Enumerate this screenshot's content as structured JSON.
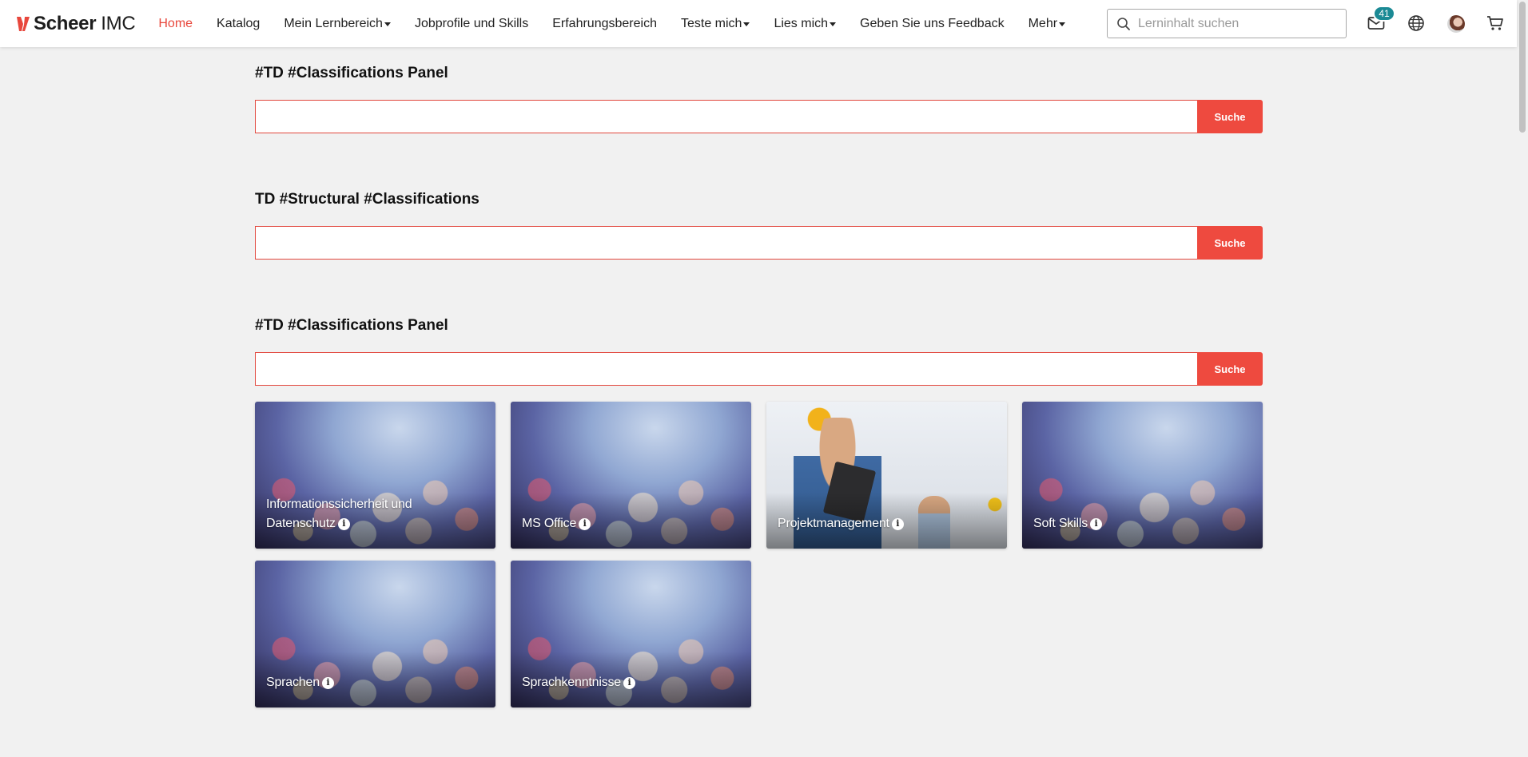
{
  "brand": {
    "name_bold": "Scheer",
    "name_light": "IMC",
    "accent": "#e8473c"
  },
  "nav": {
    "items": [
      {
        "label": "Home",
        "active": true,
        "dropdown": false
      },
      {
        "label": "Katalog",
        "active": false,
        "dropdown": false
      },
      {
        "label": "Mein Lernbereich",
        "active": false,
        "dropdown": true
      },
      {
        "label": "Jobprofile und Skills",
        "active": false,
        "dropdown": false
      },
      {
        "label": "Erfahrungsbereich",
        "active": false,
        "dropdown": false
      },
      {
        "label": "Teste mich",
        "active": false,
        "dropdown": true
      },
      {
        "label": "Lies mich",
        "active": false,
        "dropdown": true
      },
      {
        "label": "Geben Sie uns Feedback",
        "active": false,
        "dropdown": false
      },
      {
        "label": "Mehr",
        "active": false,
        "dropdown": true
      }
    ]
  },
  "header_search": {
    "placeholder": "Lerninhalt suchen",
    "value": ""
  },
  "header_icons": {
    "messages_icon": "envelope-icon",
    "messages_count": "41",
    "badge_color": "#1b8a95",
    "language_icon": "globe-icon",
    "avatar_icon": "user-avatar",
    "cart_icon": "cart-icon"
  },
  "sections": [
    {
      "title": "#TD #Classifications Panel",
      "search_value": "",
      "button_label": "Suche"
    },
    {
      "title": "TD #Structural #Classifications",
      "search_value": "",
      "button_label": "Suche"
    },
    {
      "title": "#TD #Classifications Panel",
      "search_value": "",
      "button_label": "Suche"
    }
  ],
  "tiles": [
    {
      "label": "Informationssicherheit und Datenschutz",
      "image": "bokeh-lights"
    },
    {
      "label": "MS Office",
      "image": "bokeh-lights"
    },
    {
      "label": "Projektmanagement",
      "image": "construction-workers-photo"
    },
    {
      "label": "Soft Skills",
      "image": "bokeh-lights"
    },
    {
      "label": "Sprachen",
      "image": "bokeh-lights"
    },
    {
      "label": "Sprachkenntnisse",
      "image": "bokeh-lights"
    }
  ],
  "colors": {
    "button": "#ee4a3f",
    "page_background": "#f1f1f1"
  }
}
